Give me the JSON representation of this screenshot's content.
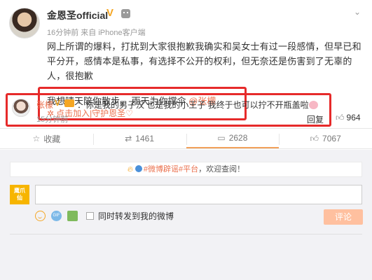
{
  "post": {
    "username": "金恩圣official",
    "meta": "16分钟前 来自 iPhone客户端",
    "text": "网上所谓的爆料，打扰到大家很抱歉我确实和吴女士有过一段感情，但早已和平分开，感情本是私事，有选择不公开的权利，但无奈还是伤害到了无辜的人，很抱歉",
    "quote_text": "我想晴天陪你散步， 雨天为你撑伞 ",
    "quote_mention": "@张檬",
    "join_link": "点击加入|守护恩圣♡"
  },
  "actions": [
    {
      "icon": "star-icon",
      "label": "收藏"
    },
    {
      "icon": "repost-icon",
      "label": "1461"
    },
    {
      "icon": "comment-icon",
      "label": "2628"
    },
    {
      "icon": "thumbs-up-icon",
      "label": "7067"
    }
  ],
  "notice": {
    "tag": "#微博辟谣#平台",
    "suffix": "，欢迎查阅！"
  },
  "composer": {
    "user_badge": "鹰爪\n仙",
    "repost_label": "同时转发到我的微博",
    "submit_label": "评论"
  },
  "comment": {
    "name": "张檬",
    "text": "：你是我的男子汉  也是我的小王子  我终于也可以拧不开瓶盖啦",
    "time": "15分钟前",
    "reply_label": "回复",
    "likes": "964"
  },
  "colors": {
    "accent": "#eb7350",
    "highlight_border": "#e62a2a",
    "verified": "#f5a623"
  }
}
